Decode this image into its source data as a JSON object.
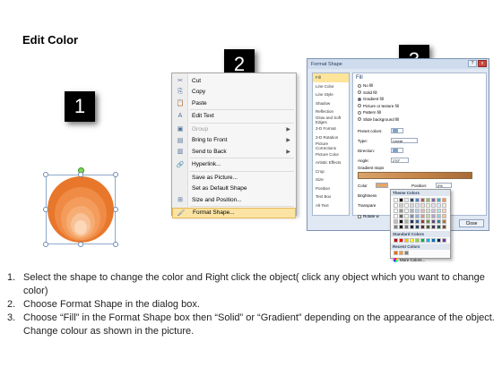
{
  "title": "Edit Color",
  "badges": [
    "1",
    "2",
    "3"
  ],
  "shape": {
    "ring_colors": [
      "#e8772b",
      "#ef8b45",
      "#f39c5c",
      "#f6ad74",
      "#f9c196",
      "#fcd7b8"
    ]
  },
  "context_menu": {
    "items": [
      {
        "icon": "cut-icon",
        "glyph": "✂",
        "label": "Cut",
        "disabled": false,
        "submenu": false
      },
      {
        "icon": "copy-icon",
        "glyph": "⎘",
        "label": "Copy",
        "disabled": false,
        "submenu": false
      },
      {
        "icon": "paste-icon",
        "glyph": "📋",
        "label": "Paste",
        "disabled": false,
        "submenu": false
      },
      {
        "icon": "edit-text-icon",
        "glyph": "A",
        "label": "Edit Text",
        "disabled": false,
        "submenu": false
      },
      {
        "icon": "group-icon",
        "glyph": "▣",
        "label": "Group",
        "disabled": true,
        "submenu": true
      },
      {
        "icon": "bring-to-front-icon",
        "glyph": "▤",
        "label": "Bring to Front",
        "disabled": false,
        "submenu": true
      },
      {
        "icon": "send-to-back-icon",
        "glyph": "▥",
        "label": "Send to Back",
        "disabled": false,
        "submenu": true
      },
      {
        "icon": "hyperlink-icon",
        "glyph": "🔗",
        "label": "Hyperlink...",
        "disabled": false,
        "submenu": false
      },
      {
        "icon": "",
        "glyph": "",
        "label": "Save as Picture...",
        "disabled": false,
        "submenu": false
      },
      {
        "icon": "",
        "glyph": "",
        "label": "Set as Default Shape",
        "disabled": false,
        "submenu": false
      },
      {
        "icon": "size-position-icon",
        "glyph": "⊞",
        "label": "Size and Position...",
        "disabled": false,
        "submenu": false
      },
      {
        "icon": "format-shape-icon",
        "glyph": "🖌",
        "label": "Format Shape...",
        "disabled": false,
        "submenu": false,
        "highlight": true
      }
    ]
  },
  "dialog": {
    "title": "Format Shape",
    "title_buttons": [
      "?",
      "x"
    ],
    "left_items": [
      "Fill",
      "Line Color",
      "Line Style",
      "Shadow",
      "Reflection",
      "Glow and Soft Edges",
      "3-D Format",
      "3-D Rotation",
      "Picture Corrections",
      "Picture Color",
      "Artistic Effects",
      "Crop",
      "Size",
      "Position",
      "Text Box",
      "Alt Text"
    ],
    "active_left": "Fill",
    "fill_heading": "Fill",
    "fill_options": [
      {
        "label": "No fill",
        "on": false
      },
      {
        "label": "Solid fill",
        "on": false
      },
      {
        "label": "Gradient fill",
        "on": true
      },
      {
        "label": "Picture or texture fill",
        "on": false
      },
      {
        "label": "Pattern fill",
        "on": false
      },
      {
        "label": "Slide background fill",
        "on": false
      }
    ],
    "preset_label": "Preset colors:",
    "type_label": "Type:",
    "type_value": "Linear",
    "direction_label": "Direction:",
    "angle_label": "Angle:",
    "angle_value": "270°",
    "stops_label": "Gradient stops",
    "color_label": "Color",
    "position_label": "Position:",
    "position_value": "0%",
    "brightness_label": "Brightness",
    "transparency_label": "Transpare",
    "rotate_label": "Rotate w",
    "close_label": "Close"
  },
  "color_popup": {
    "theme_heading": "Theme Colors",
    "standard_heading": "Standard Colors",
    "recent_heading": "Recent Colors",
    "more_label": "More Colors...",
    "theme_colors": [
      "#ffffff",
      "#000000",
      "#eeece1",
      "#1f497d",
      "#4f81bd",
      "#c0504d",
      "#9bbb59",
      "#8064a2",
      "#4bacc6",
      "#f79646"
    ],
    "standard_colors": [
      "#c00000",
      "#ff0000",
      "#ffc000",
      "#ffff00",
      "#92d050",
      "#00b050",
      "#00b0f0",
      "#0070c0",
      "#002060",
      "#7030a0"
    ],
    "recent_colors": [
      "#e46c0a",
      "#f79646",
      "#7f7f7f"
    ]
  },
  "instructions": [
    {
      "num": "1.",
      "text": "Select the shape to change the color and Right click the object( click any object which you want to change color)"
    },
    {
      "num": "2.",
      "text": "Choose Format Shape in the dialog box."
    },
    {
      "num": "3.",
      "text": "Choose “Fill” in the Format Shape box then “Solid” or “Gradient” depending on the appearance of the object. Change colour as shown in the picture."
    }
  ]
}
